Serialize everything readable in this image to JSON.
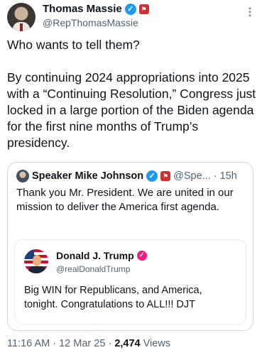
{
  "tweet": {
    "author_name": "Thomas Massie",
    "author_handle": "@RepThomasMassie",
    "text_line1": "Who wants to tell them?",
    "text_body": "By continuing 2024 appropriations into 2025 with a “Continuing Resolution,” Congress just locked in a large portion of the Biden agenda for the first nine months of Trump’s presidency.",
    "verified_glyph": "✓",
    "gov_glyph": "⚑",
    "more_glyph": "⋮",
    "icons": [
      "verified-badge-icon",
      "government-badge-icon",
      "more-options-icon"
    ]
  },
  "quote": {
    "author_name": "Speaker Mike Johnson",
    "author_handle": "@Spe...",
    "time": "· 15h",
    "text": "Thank you Mr. President. We are united in our mission to deliver the America first agenda.",
    "inner": {
      "author_name": "Donald J. Trump",
      "author_handle": "@realDonaldTrump",
      "text": "Big WIN for Republicans, and America, tonight. Congratulations to ALL!!! DJT"
    }
  },
  "meta": {
    "time": "11:16 AM",
    "separator": "·",
    "date": "12 Mar 25",
    "views_count": "2,474",
    "views_label": "Views"
  },
  "colors": {
    "accent": "#1d9bf0",
    "gov_badge": "#d0302f",
    "trump_check": "#f91880",
    "secondary_text": "#536471"
  }
}
